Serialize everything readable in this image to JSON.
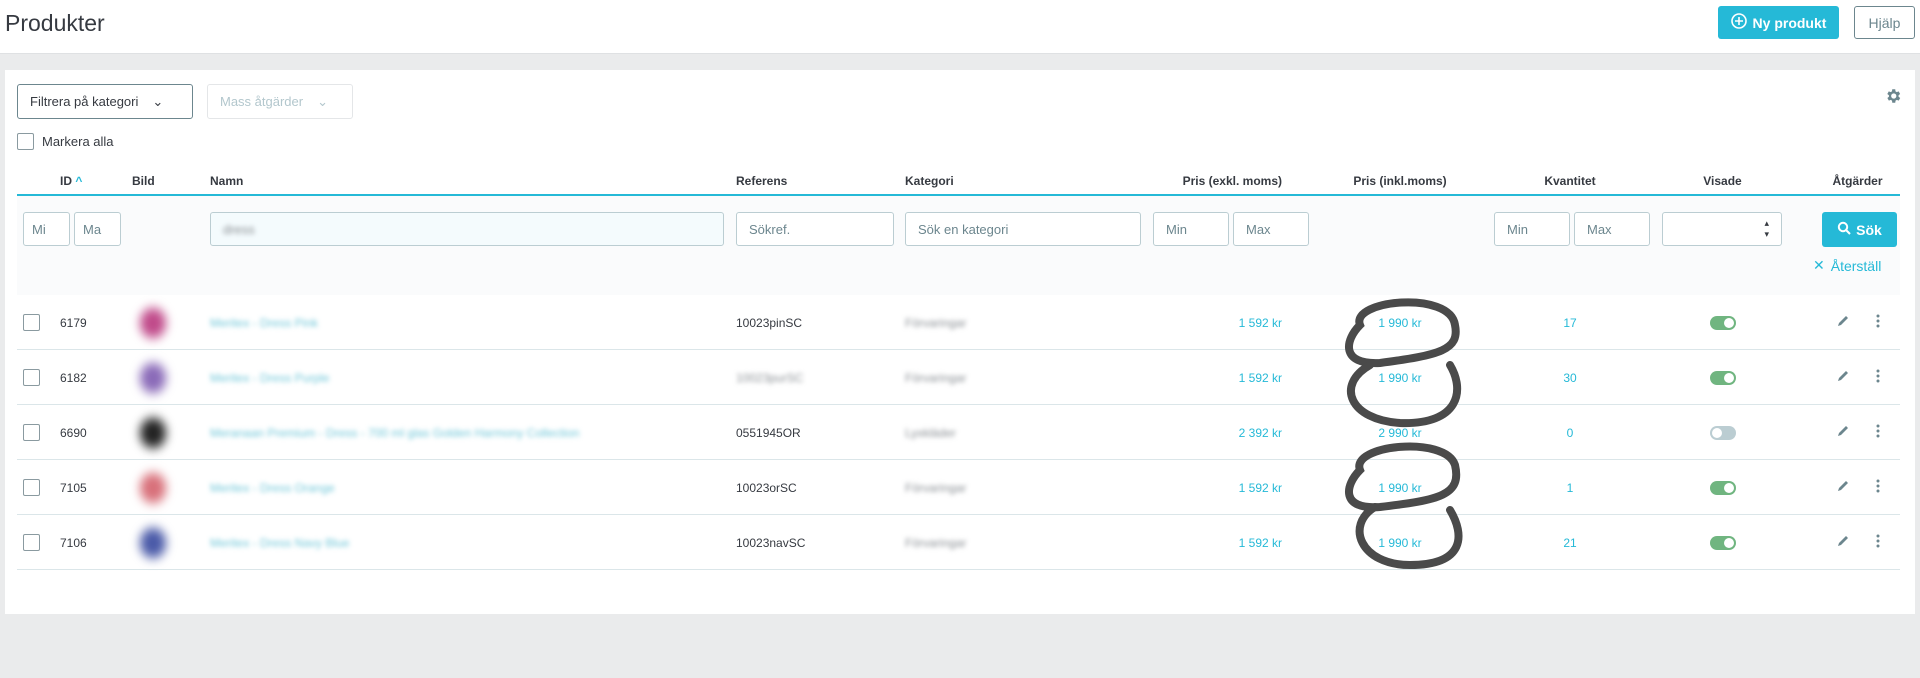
{
  "header": {
    "title": "Produkter",
    "new_product": "Ny produkt",
    "help": "Hjälp"
  },
  "toolbar": {
    "filter_category": "Filtrera på kategori",
    "bulk_actions": "Mass åtgärder",
    "select_all": "Markera alla"
  },
  "columns": {
    "id": "ID",
    "image": "Bild",
    "name": "Namn",
    "reference": "Referens",
    "category": "Kategori",
    "price_excl": "Pris (exkl. moms)",
    "price_incl": "Pris (inkl.moms)",
    "quantity": "Kvantitet",
    "active": "Visade",
    "actions": "Åtgärder"
  },
  "filters": {
    "id_min": "Mi",
    "id_max": "Ma",
    "name_value": "dress",
    "reference_placeholder": "Sökref.",
    "category_placeholder": "Sök en kategori",
    "price_min": "Min",
    "price_max": "Max",
    "qty_min": "Min",
    "qty_max": "Max",
    "search": "Sök",
    "reset": "Återställ"
  },
  "colors": {
    "accent": "#25b9d7",
    "toggle_on": "#70b580",
    "toggle_off": "#bbcdd2"
  },
  "rows": [
    {
      "id": "6179",
      "name": "Meritex - Dress Pink",
      "reference": "10023pinSC",
      "category": "Förvaringar",
      "price_excl": "1 592 kr",
      "price_incl": "1 990 kr",
      "quantity": "17",
      "active": true,
      "thumb": "#c04a8a"
    },
    {
      "id": "6182",
      "name": "Meritex - Dress Purple",
      "reference": "10023purSC",
      "category": "Förvaringar",
      "price_excl": "1 592 kr",
      "price_incl": "1 990 kr",
      "quantity": "30",
      "active": true,
      "thumb": "#8a6ab8"
    },
    {
      "id": "6690",
      "name": "Meranaan Premium - Dress - 700 ml glas Golden Harmony Collection",
      "reference": "0551945OR",
      "category": "Lyxkläder",
      "price_excl": "2 392 kr",
      "price_incl": "2 990 kr",
      "quantity": "0",
      "active": false,
      "thumb": "#222222"
    },
    {
      "id": "7105",
      "name": "Meritex - Dress Orange",
      "reference": "10023orSC",
      "category": "Förvaringar",
      "price_excl": "1 592 kr",
      "price_incl": "1 990 kr",
      "quantity": "1",
      "active": true,
      "thumb": "#d8707a"
    },
    {
      "id": "7106",
      "name": "Meritex - Dress Navy Blue",
      "reference": "10023navSC",
      "category": "Förvaringar",
      "price_excl": "1 592 kr",
      "price_incl": "1 990 kr",
      "quantity": "21",
      "active": true,
      "thumb": "#4a5aa8"
    }
  ]
}
